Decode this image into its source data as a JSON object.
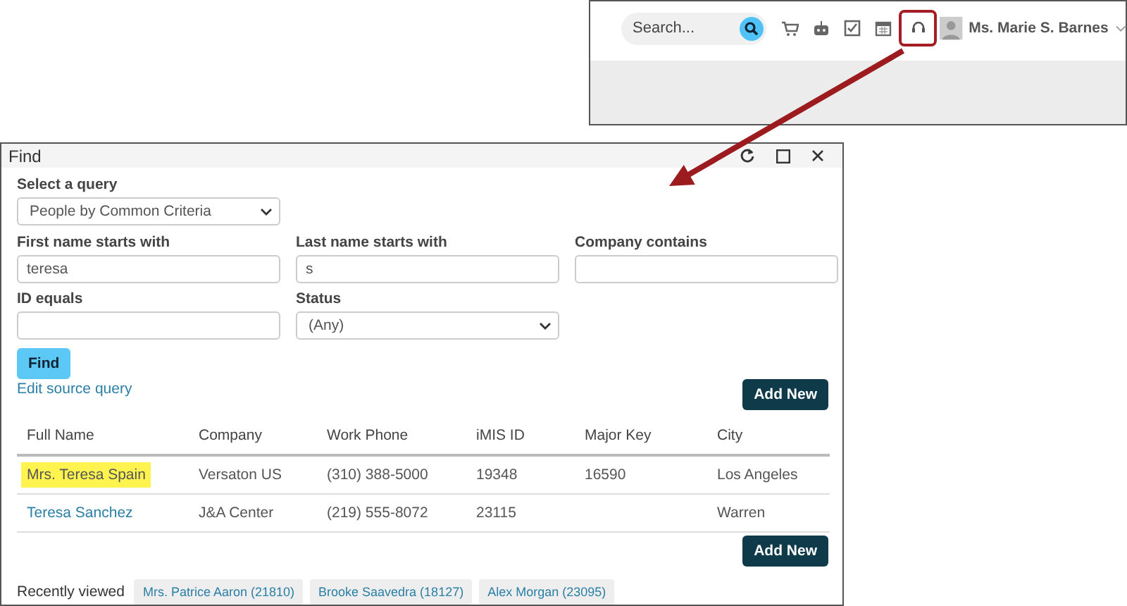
{
  "top_bar": {
    "search": {
      "placeholder": "Search..."
    },
    "icons": [
      {
        "kind": "cart",
        "highlighted": false
      },
      {
        "kind": "robot",
        "highlighted": false
      },
      {
        "kind": "checklist",
        "highlighted": false
      },
      {
        "kind": "calendar",
        "highlighted": false
      },
      {
        "kind": "headset",
        "highlighted": true
      }
    ],
    "user": {
      "name": "Ms. Marie S. Barnes"
    }
  },
  "dialog": {
    "title": "Find",
    "query": {
      "label": "Select a query",
      "value": "People by Common Criteria"
    },
    "fields": [
      {
        "label": "First name starts with",
        "kind": "text",
        "value": "teresa"
      },
      {
        "label": "Last name starts with",
        "kind": "text",
        "value": "s"
      },
      {
        "label": "Company contains",
        "kind": "text"
      },
      {
        "label": "ID equals",
        "kind": "text"
      },
      {
        "label": "Status",
        "kind": "select",
        "value": "(Any)"
      }
    ],
    "find_button": "Find",
    "edit_link": "Edit source query",
    "add_new_buttons": [
      "Add New",
      "Add New"
    ],
    "table": {
      "columns": [
        "Full Name",
        "Company",
        "Work Phone",
        "iMIS ID",
        "Major Key",
        "City"
      ],
      "rows": [
        {
          "selected": true,
          "cells": [
            "Mrs. Teresa Spain",
            "Versaton US",
            "(310) 388-5000",
            "19348",
            "16590",
            "Los Angeles"
          ]
        },
        {
          "selected": false,
          "cells": [
            "Teresa Sanchez",
            "J&A Center",
            "(219) 555-8072",
            "23115",
            "",
            "Warren"
          ]
        }
      ]
    },
    "recently_viewed": {
      "label": "Recently viewed",
      "items": [
        "Mrs. Patrice Aaron (21810)",
        "Brooke Saavedra (18127)",
        "Alex Morgan (23095)"
      ]
    }
  }
}
